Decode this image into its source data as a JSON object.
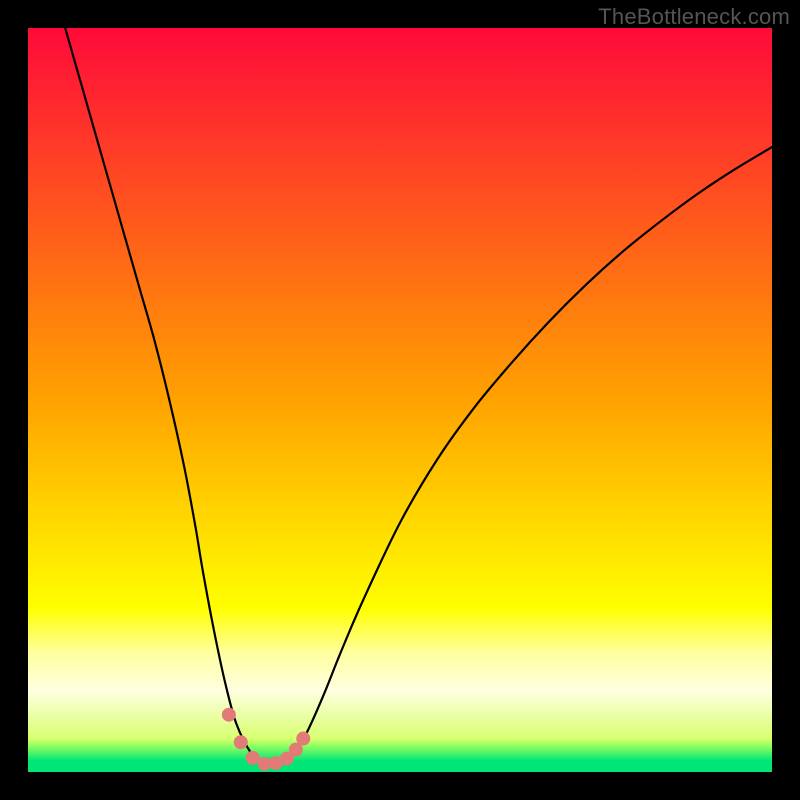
{
  "branding": {
    "watermark": "TheBottleneck.com"
  },
  "colors": {
    "frame_bg": "#000000",
    "watermark_text": "#555555",
    "curve_stroke": "#000000",
    "dot_fill": "#e27a78",
    "gradient_stops": [
      {
        "y_frac": 0.0,
        "color": "#ff0a3a"
      },
      {
        "y_frac": 0.5,
        "color": "#ffa200"
      },
      {
        "y_frac": 0.78,
        "color": "#ffff00"
      },
      {
        "y_frac": 0.84,
        "color": "#ffffa0"
      },
      {
        "y_frac": 0.89,
        "color": "#ffffe0"
      },
      {
        "y_frac": 0.955,
        "color": "#d8ff70"
      },
      {
        "y_frac": 0.965,
        "color": "#90ff60"
      },
      {
        "y_frac": 0.985,
        "color": "#00e676"
      },
      {
        "y_frac": 1.0,
        "color": "#00e676"
      }
    ]
  },
  "chart_data": {
    "type": "line",
    "title": "",
    "xlabel": "",
    "ylabel": "",
    "xlim": [
      0,
      100
    ],
    "ylim": [
      0,
      100
    ],
    "grid": false,
    "legend": false,
    "series": [
      {
        "name": "bottleneck-curve",
        "x": [
          5,
          7,
          9,
          11,
          13,
          15,
          17,
          19,
          21,
          22.5,
          23.5,
          25,
          26.5,
          28,
          30,
          31.5,
          33,
          34,
          35,
          36.5,
          38,
          40,
          42,
          45,
          50,
          55,
          60,
          65,
          70,
          75,
          80,
          85,
          90,
          95,
          100
        ],
        "y": [
          100,
          93,
          86,
          79,
          72,
          65,
          58,
          50,
          41,
          33,
          27,
          19,
          12,
          6.5,
          2.5,
          1.2,
          1.0,
          1.2,
          1.8,
          3.5,
          6.4,
          11,
          16,
          23,
          33.5,
          42,
          49,
          55,
          60.5,
          65.5,
          70,
          74,
          77.7,
          81,
          84
        ]
      }
    ],
    "annotations": {
      "valley_dots": [
        {
          "x": 27,
          "y": 7.7
        },
        {
          "x": 28.6,
          "y": 4
        },
        {
          "x": 30.2,
          "y": 1.9
        },
        {
          "x": 31.8,
          "y": 1.1
        },
        {
          "x": 33.3,
          "y": 1.2
        },
        {
          "x": 34.8,
          "y": 1.8
        },
        {
          "x": 36,
          "y": 3
        },
        {
          "x": 37,
          "y": 4.5
        }
      ]
    }
  }
}
